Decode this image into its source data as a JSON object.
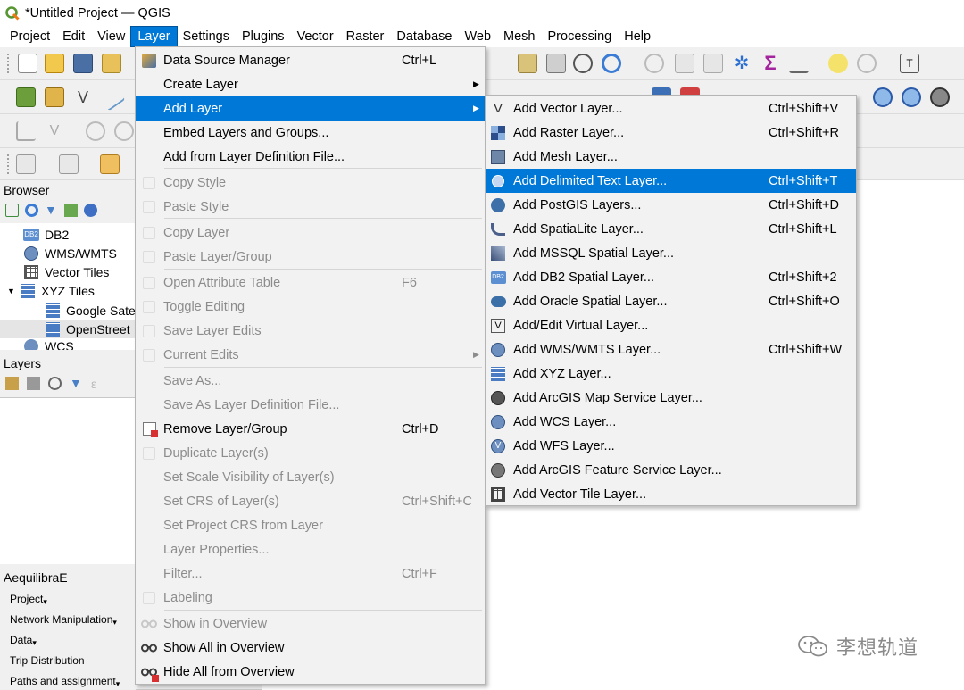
{
  "window": {
    "title": "*Untitled Project — QGIS"
  },
  "menubar": [
    "Project",
    "Edit",
    "View",
    "Layer",
    "Settings",
    "Plugins",
    "Vector",
    "Raster",
    "Database",
    "Web",
    "Mesh",
    "Processing",
    "Help"
  ],
  "browser": {
    "title": "Browser",
    "items": [
      "DB2",
      "WMS/WMTS",
      "Vector Tiles",
      "XYZ Tiles",
      "Google Sate",
      "OpenStreet",
      "WCS"
    ]
  },
  "layers": {
    "title": "Layers"
  },
  "aequilibrae": {
    "title": "AequilibraE",
    "buttons": [
      "Project",
      "Network Manipulation",
      "Data",
      "Trip Distribution",
      "Paths and assignment"
    ]
  },
  "layer_menu": [
    {
      "label": "Data Source Manager",
      "shortcut": "Ctrl+L",
      "icon": "data-source-manager-icon"
    },
    {
      "label": "Create Layer",
      "submenu": true
    },
    {
      "label": "Add Layer",
      "submenu": true,
      "highlight": true
    },
    {
      "label": "Embed Layers and Groups..."
    },
    {
      "label": "Add from Layer Definition File..."
    },
    {
      "label": "Copy Style",
      "disabled": true,
      "icon": "copy-style-icon"
    },
    {
      "label": "Paste Style",
      "disabled": true,
      "icon": "paste-style-icon"
    },
    {
      "label": "Copy Layer",
      "disabled": true,
      "icon": "copy-layer-icon"
    },
    {
      "label": "Paste Layer/Group",
      "disabled": true,
      "icon": "paste-layer-icon"
    },
    {
      "label": "Open Attribute Table",
      "shortcut": "F6",
      "disabled": true,
      "icon": "attribute-table-icon"
    },
    {
      "label": "Toggle Editing",
      "disabled": true,
      "icon": "pencil-icon"
    },
    {
      "label": "Save Layer Edits",
      "disabled": true,
      "icon": "save-edits-icon"
    },
    {
      "label": "Current Edits",
      "disabled": true,
      "submenu": true,
      "icon": "current-edits-icon"
    },
    {
      "label": "Save As...",
      "disabled": true
    },
    {
      "label": "Save As Layer Definition File...",
      "disabled": true
    },
    {
      "label": "Remove Layer/Group",
      "shortcut": "Ctrl+D",
      "icon": "remove-layer-icon"
    },
    {
      "label": "Duplicate Layer(s)",
      "disabled": true,
      "icon": "duplicate-layer-icon"
    },
    {
      "label": "Set Scale Visibility of Layer(s)",
      "disabled": true
    },
    {
      "label": "Set CRS of Layer(s)",
      "shortcut": "Ctrl+Shift+C",
      "disabled": true
    },
    {
      "label": "Set Project CRS from Layer",
      "disabled": true
    },
    {
      "label": "Layer Properties...",
      "disabled": true
    },
    {
      "label": "Filter...",
      "shortcut": "Ctrl+F",
      "disabled": true
    },
    {
      "label": "Labeling",
      "disabled": true,
      "icon": "labeling-icon"
    },
    {
      "label": "Show in Overview",
      "disabled": true,
      "icon": "glasses-icon"
    },
    {
      "label": "Show All in Overview",
      "icon": "glasses-icon"
    },
    {
      "label": "Hide All from Overview",
      "icon": "glasses-hide-icon"
    }
  ],
  "add_layer_menu": [
    {
      "label": "Add Vector Layer...",
      "shortcut": "Ctrl+Shift+V",
      "icon": "vector-layer-icon"
    },
    {
      "label": "Add Raster Layer...",
      "shortcut": "Ctrl+Shift+R",
      "icon": "raster-layer-icon"
    },
    {
      "label": "Add Mesh Layer...",
      "icon": "mesh-layer-icon"
    },
    {
      "label": "Add Delimited Text Layer...",
      "shortcut": "Ctrl+Shift+T",
      "icon": "delimited-text-icon",
      "highlight": true
    },
    {
      "label": "Add PostGIS Layers...",
      "shortcut": "Ctrl+Shift+D",
      "icon": "postgis-icon"
    },
    {
      "label": "Add SpatiaLite Layer...",
      "shortcut": "Ctrl+Shift+L",
      "icon": "spatialite-icon"
    },
    {
      "label": "Add MSSQL Spatial Layer...",
      "icon": "mssql-icon"
    },
    {
      "label": "Add DB2 Spatial Layer...",
      "shortcut": "Ctrl+Shift+2",
      "icon": "db2-icon"
    },
    {
      "label": "Add Oracle Spatial Layer...",
      "shortcut": "Ctrl+Shift+O",
      "icon": "oracle-icon"
    },
    {
      "label": "Add/Edit Virtual Layer...",
      "icon": "virtual-layer-icon"
    },
    {
      "label": "Add WMS/WMTS Layer...",
      "shortcut": "Ctrl+Shift+W",
      "icon": "wms-icon"
    },
    {
      "label": "Add XYZ Layer...",
      "icon": "xyz-icon"
    },
    {
      "label": "Add ArcGIS Map Service Layer...",
      "icon": "arcgis-map-icon"
    },
    {
      "label": "Add WCS Layer...",
      "icon": "wcs-icon"
    },
    {
      "label": "Add WFS Layer...",
      "icon": "wfs-icon"
    },
    {
      "label": "Add ArcGIS Feature Service Layer...",
      "icon": "arcgis-feature-icon"
    },
    {
      "label": "Add Vector Tile Layer...",
      "icon": "vector-tile-icon"
    }
  ],
  "watermark": {
    "text": "李想轨道"
  },
  "colors": {
    "highlight": "#0078d7",
    "menu_bg": "#f2f2f2",
    "toolbar_bg": "#f0f0f0",
    "disabled": "#8c8c8c"
  }
}
